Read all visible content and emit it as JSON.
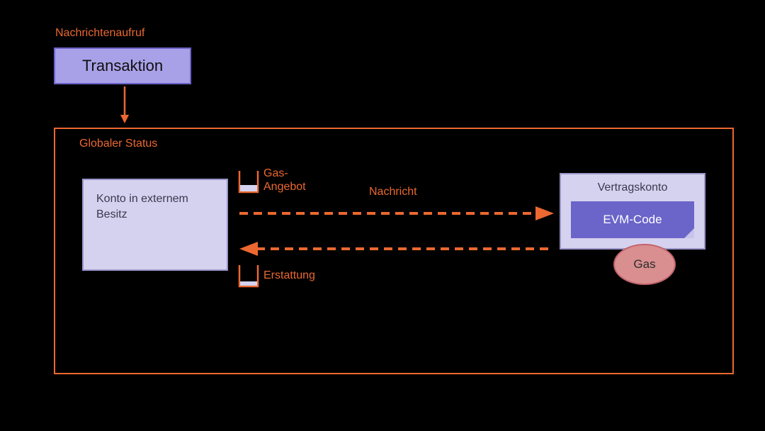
{
  "labels": {
    "messageCall": "Nachrichtenaufruf",
    "transaction": "Transaktion",
    "globalState": "Globaler Status",
    "externalAccount": "Konto in externem Besitz",
    "gasSupplyLine1": "Gas-",
    "gasSupplyLine2": "Angebot",
    "message": "Nachricht",
    "refund": "Erstattung",
    "contractAccount": "Vertragskonto",
    "evmCode": "EVM-Code",
    "gas": "Gas"
  },
  "colors": {
    "orange": "#ec6830",
    "purpleLight": "#d5d2ef",
    "purpleMid": "#a9a1e8",
    "purpleDark": "#6b64c9",
    "gasRed": "#d98f8f"
  }
}
